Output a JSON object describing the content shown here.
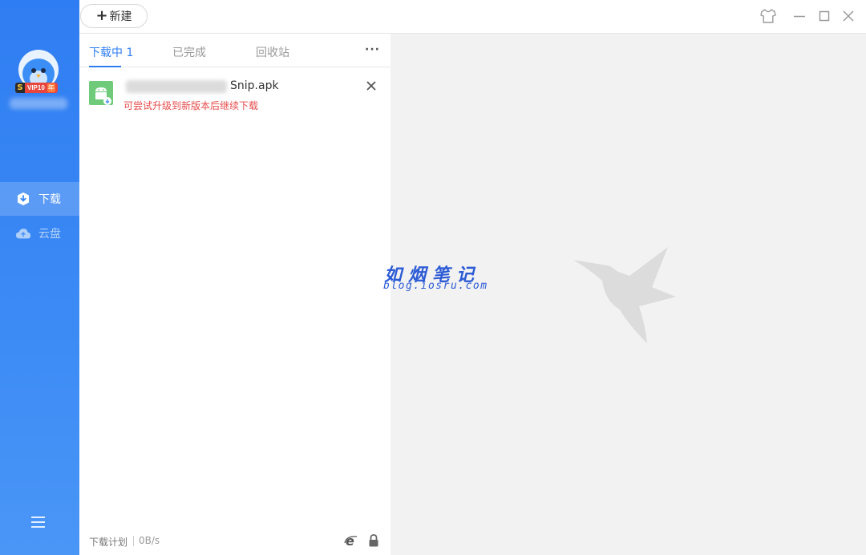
{
  "sidebar": {
    "vip_badge": {
      "s": "S",
      "text": "VIP10",
      "year": "年"
    },
    "nav": [
      {
        "label": "下载",
        "icon": "download-shield-icon",
        "active": true
      },
      {
        "label": "云盘",
        "icon": "cloud-icon",
        "active": false
      }
    ],
    "menu_icon": "hamburger-menu-icon"
  },
  "topbar": {
    "new_label": "新建",
    "controls": [
      "skin-shirt-icon",
      "minimize-icon",
      "maximize-icon",
      "close-icon"
    ]
  },
  "tabs": [
    {
      "label": "下载中 1",
      "active": true
    },
    {
      "label": "已完成",
      "active": false
    },
    {
      "label": "回收站",
      "active": false
    }
  ],
  "more_label": "···",
  "download_item": {
    "filename_suffix": "Snip.apk",
    "error": "可尝试升级到新版本后继续下载",
    "icon": "android-apk-icon"
  },
  "footer": {
    "plan_label": "下载计划",
    "speed": "0B/s",
    "icons": [
      "ie-browser-icon",
      "lock-icon"
    ]
  },
  "watermark": {
    "title": "如烟笔记",
    "url": "blog.iosru.com"
  },
  "colors": {
    "accent": "#2f7df2",
    "error": "#e84b4b",
    "sidebar": "#3c8bf5"
  }
}
